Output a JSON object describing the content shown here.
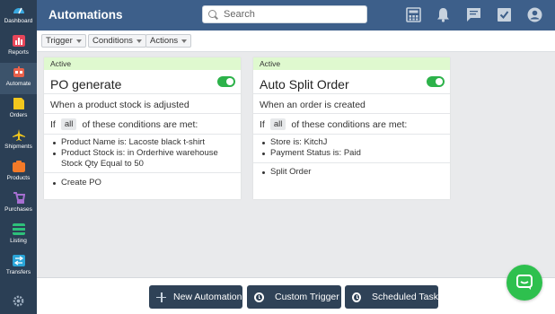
{
  "app": {
    "title": "Automations"
  },
  "search": {
    "placeholder": "Search"
  },
  "sidebar": {
    "items": [
      {
        "label": "Dashboard",
        "icon": "dashboard-icon",
        "color": "#3aa8e0"
      },
      {
        "label": "Reports",
        "icon": "reports-icon",
        "color": "#e8465a"
      },
      {
        "label": "Automate",
        "icon": "robot-icon",
        "color": "#e8604a",
        "active": true
      },
      {
        "label": "Orders",
        "icon": "orders-icon",
        "color": "#f2c71d"
      },
      {
        "label": "Shipments",
        "icon": "airplane-icon",
        "color": "#f2c71d"
      },
      {
        "label": "Products",
        "icon": "products-icon",
        "color": "#f47a28"
      },
      {
        "label": "Purchases",
        "icon": "purchases-icon",
        "color": "#a66fd1"
      },
      {
        "label": "Listing",
        "icon": "listing-icon",
        "color": "#2ec07a"
      },
      {
        "label": "Transfers",
        "icon": "transfers-icon",
        "color": "#2aa5d8"
      }
    ],
    "settings_icon": "gear-icon"
  },
  "header_icons": [
    "calculator-icon",
    "bell-icon",
    "chat-icon",
    "checkbox-icon",
    "user-icon"
  ],
  "filters": [
    {
      "label": "Trigger"
    },
    {
      "label": "Conditions"
    },
    {
      "label": "Actions"
    }
  ],
  "cards": [
    {
      "status": "Active",
      "title": "PO generate",
      "enabled": true,
      "trigger": "When a product stock is adjusted",
      "cond_prefix": "If",
      "cond_chip": "all",
      "cond_suffix": "of these conditions are met:",
      "conditions": [
        "Product Name is: Lacoste black t-shirt",
        "Product Stock is:  in Orderhive warehouse Stock Qty Equal to 50"
      ],
      "actions": [
        "Create PO"
      ]
    },
    {
      "status": "Active",
      "title": "Auto Split Order",
      "enabled": true,
      "trigger": "When an order is created",
      "cond_prefix": "If",
      "cond_chip": "all",
      "cond_suffix": "of these conditions are met:",
      "conditions": [
        "Store is: KitchJ",
        "Payment Status is: Paid"
      ],
      "actions": [
        "Split Order"
      ]
    }
  ],
  "bottom_actions": [
    {
      "label": "New Automation",
      "icon": "plus-icon"
    },
    {
      "label": "Custom Trigger",
      "icon": "clock-icon"
    },
    {
      "label": "Scheduled Task",
      "icon": "clock-icon"
    }
  ],
  "colors": {
    "header": "#3d5f8a",
    "sidebar": "#2b3f55",
    "active_badge": "#dff9cf",
    "toggle_on": "#2db24a",
    "chat": "#2ec04e"
  }
}
